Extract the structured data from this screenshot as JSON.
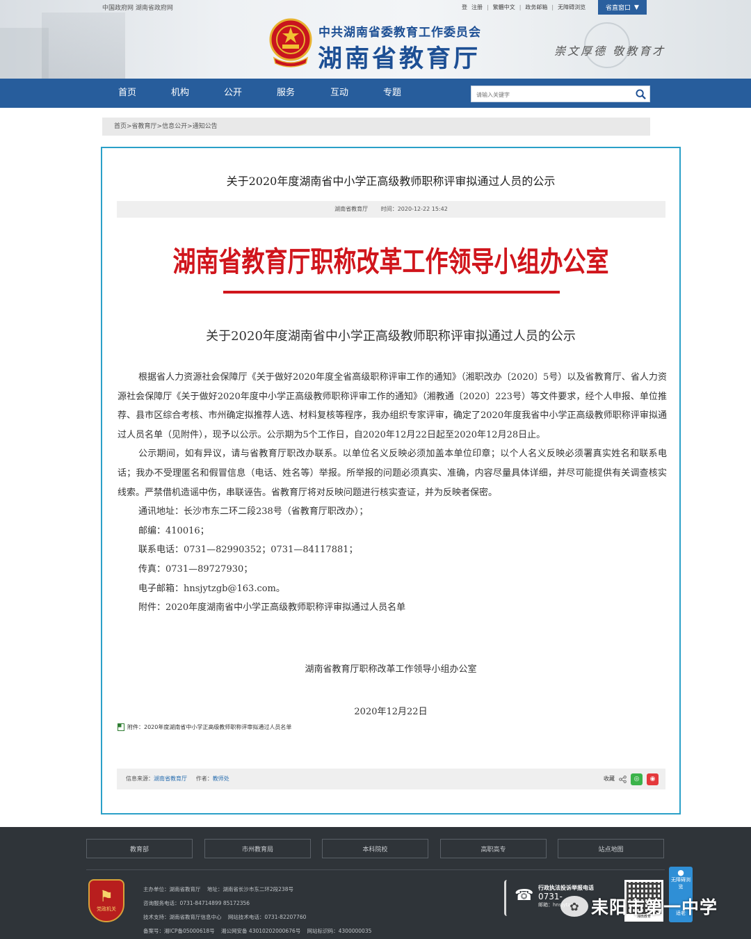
{
  "header": {
    "top_links": "中国政府网 湖南省政府网",
    "user_links": [
      "登",
      "注册",
      "繁體中文",
      "政务邮箱",
      "无障碍浏览"
    ],
    "portal_label": "省直窗口",
    "subtitle": "中共湖南省委教育工作委员会",
    "title": "湖南省教育厅",
    "motto": "崇文厚德  敬教育才"
  },
  "nav": {
    "items": [
      "首页",
      "机构",
      "公开",
      "服务",
      "互动",
      "专题"
    ],
    "search_placeholder": "请输入关键字"
  },
  "breadcrumb": "首页>省教育厅>信息公开>通知公告",
  "article": {
    "title": "关于2020年度湖南省中小学正高级教师职称评审拟通过人员的公示",
    "source": "湖南省教育厅",
    "time_label": "时间：",
    "time": "2020-12-22 15:42",
    "red_header": "湖南省教育厅职称改革工作领导小组办公室",
    "doc_title": "关于2020年度湖南省中小学正高级教师职称评审拟通过人员的公示",
    "para1": "根据省人力资源社会保障厅《关于做好2020年度全省高级职称评审工作的通知》（湘职改办〔2020〕5号）以及省教育厅、省人力资源社会保障厅《关于做好2020年度中小学正高级教师职称评审工作的通知》（湘教通〔2020〕223号）等文件要求，经个人申报、单位推荐、县市区综合考核、市州确定拟推荐人选、材料复核等程序，我办组织专家评审，确定了2020年度我省中小学正高级教师职称评审拟通过人员名单（见附件），现予以公示。公示期为5个工作日，自2020年12月22日起至2020年12月28日止。",
    "para2": "公示期间，如有异议，请与省教育厅职改办联系。以单位名义反映必须加盖本单位印章；以个人名义反映必须署真实姓名和联系电话；我办不受理匿名和假冒信息（电话、姓名等）举报。所举报的问题必须真实、准确，内容尽量具体详细，并尽可能提供有关调查核实线索。严禁借机造谣中伤，串联诬告。省教育厅将对反映问题进行核实查证，并为反映者保密。",
    "address": "通讯地址：长沙市东二环二段238号（省教育厅职改办）；",
    "postcode": "邮编：410016；",
    "phone": "联系电话：0731—82990352；0731—84117881；",
    "fax": "传真：0731—89727930；",
    "email": "电子邮箱：hnsjytzgb@163.com。",
    "attachment_line": "附件：2020年度湖南省中小学正高级教师职称评审拟通过人员名单",
    "signer": "湖南省教育厅职称改革工作领导小组办公室",
    "date": "2020年12月22日",
    "attachment_link": "附件：2020年度湖南省中小学正高级教师职称评审拟通过人员名单",
    "info_source_label": "信息来源：",
    "info_source": "湖南省教育厅",
    "author_label": "作者：",
    "author": "教师处",
    "collect_label": "收藏"
  },
  "footer": {
    "links": [
      "教育部",
      "市州教育局",
      "本科院校",
      "高职高专",
      "站点地图"
    ],
    "badge_text": "党政机关",
    "info": [
      [
        "主办单位：湖南省教育厅",
        "地址：湖南省长沙市东二环2段238号"
      ],
      [
        "咨询服务电话：0731-84714899 85172356"
      ],
      [
        "技术支持：湖南省教育厅信息中心",
        "网站技术电话：0731-82207760"
      ],
      [
        "备案号：湘ICP备05000618号",
        "湘公网安备 43010202000676号",
        "网站标识码：4300000035"
      ]
    ],
    "hotline_title": "行政执法投诉举报电话",
    "hotline_number": "0731-",
    "hotline_email": "邮箱：hnsjytzcfc",
    "qr_caption": "湘微教育",
    "a11y_label": "无障碍浏览",
    "a11y_label2": "适老",
    "watermark": "耒阳市第一中学"
  },
  "colors": {
    "nav_blue": "#275d9c",
    "frame_cyan": "#2aa0c8",
    "red_head": "#d0151c",
    "footer_bg": "#2f3439"
  }
}
